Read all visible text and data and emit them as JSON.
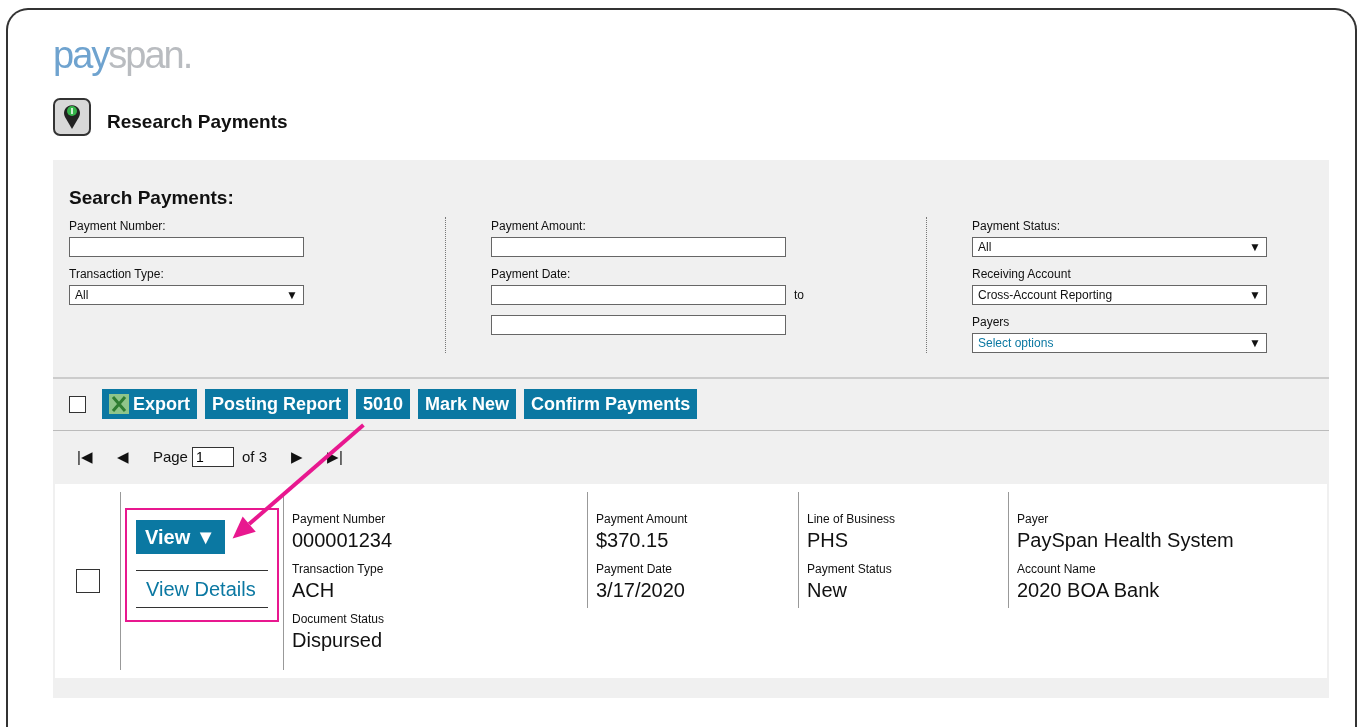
{
  "logo": {
    "primary": "pay",
    "secondary": "span."
  },
  "page_title": "Research Payments",
  "search": {
    "title": "Search Payments:",
    "columns": [
      [
        {
          "label": "Payment Number:",
          "kind": "text"
        },
        {
          "label": "Transaction Type:",
          "kind": "select",
          "value": "All",
          "arrow": "▼"
        }
      ],
      [
        {
          "label": "Payment Amount:",
          "kind": "text"
        },
        {
          "label": "Payment Date:",
          "kind": "daterange",
          "separator": "to"
        }
      ],
      [
        {
          "label": "Payment Status:",
          "kind": "select",
          "value": "All",
          "arrow": "▼"
        },
        {
          "label": "Receiving Account",
          "kind": "select",
          "value": "Cross-Account Reporting",
          "arrow": "▼"
        },
        {
          "label": "Payers",
          "kind": "select",
          "placeholder": "Select options",
          "arrow": "▼"
        }
      ]
    ]
  },
  "toolbar": {
    "select_all": {
      "checked": false
    },
    "buttons": [
      {
        "label": "Export",
        "kind": "spreadsheet"
      },
      {
        "label": "Posting Report",
        "kind": "plain"
      },
      {
        "label": "5010",
        "kind": "plain"
      },
      {
        "label": "Mark New",
        "kind": "plain"
      },
      {
        "label": "Confirm Payments",
        "kind": "plain"
      }
    ]
  },
  "pager": {
    "first": "|◀",
    "prev": "◀",
    "page_label": "Page",
    "page": "1",
    "of": "of 3",
    "next": "▶",
    "last": "▶|"
  },
  "result": {
    "checked": false,
    "view_button": "View ▼",
    "menu_item": "View Details",
    "columns": [
      [
        {
          "label": "Payment Number",
          "value": "000001234"
        },
        {
          "label": "Transaction Type",
          "value": "ACH"
        },
        {
          "label": "Document Status",
          "value": "Dispursed"
        }
      ],
      [
        {
          "label": "Payment Amount",
          "value": "$370.15"
        },
        {
          "label": "Payment Date",
          "value": "3/17/2020"
        }
      ],
      [
        {
          "label": "Line of Business",
          "value": "PHS"
        },
        {
          "label": "Payment Status",
          "value": "New"
        }
      ],
      [
        {
          "label": "Payer",
          "value": "PaySpan Health System"
        },
        {
          "label": "Account Name",
          "value": "2020 BOA Bank"
        }
      ]
    ]
  }
}
